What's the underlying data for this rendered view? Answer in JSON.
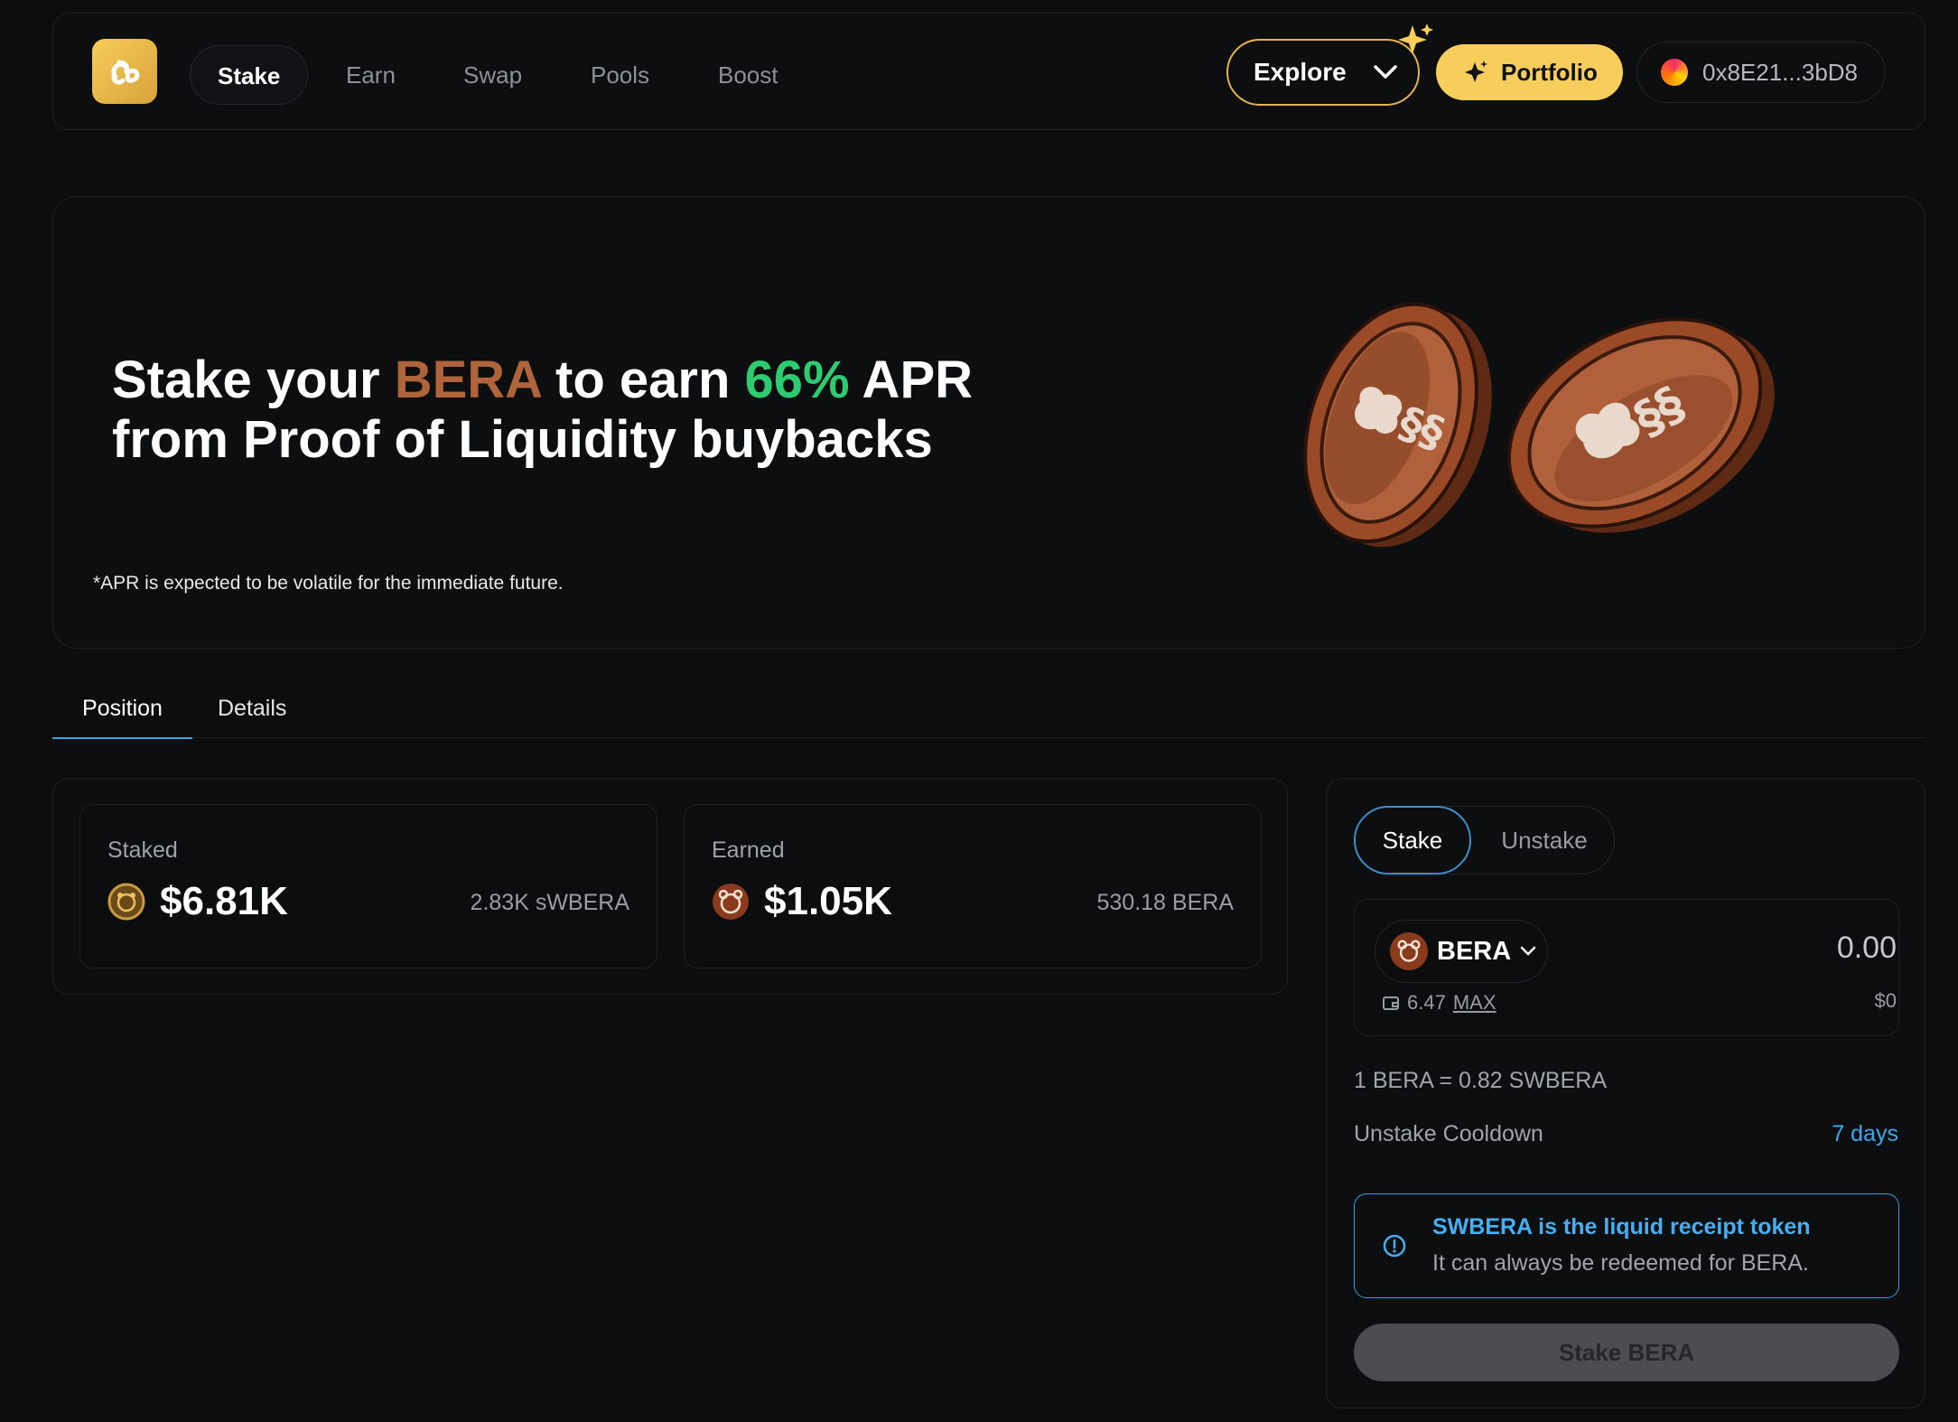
{
  "nav": {
    "links": [
      "Stake",
      "Earn",
      "Swap",
      "Pools",
      "Boost"
    ],
    "explore": "Explore",
    "portfolio": "Portfolio",
    "wallet": "0x8E21...3bD8"
  },
  "hero": {
    "line1_a": "Stake your ",
    "line1_b": "BERA",
    "line1_c": " to earn ",
    "line1_d": "66%",
    "line1_e": " APR",
    "line2": "from Proof of Liquidity buybacks",
    "disclaimer": "*APR is expected to be volatile for the immediate future."
  },
  "tabs": {
    "position": "Position",
    "details": "Details"
  },
  "position": {
    "staked": {
      "label": "Staked",
      "value": "$6.81K",
      "amount": "2.83K  sWBERA"
    },
    "earned": {
      "label": "Earned",
      "value": "$1.05K",
      "amount": "530.18  BERA"
    }
  },
  "stake": {
    "tab_stake": "Stake",
    "tab_unstake": "Unstake",
    "token": "BERA",
    "amount": "0.00",
    "usd": "$0",
    "balance": "6.47",
    "max": "MAX",
    "rate": "1 BERA = 0.82 SWBERA",
    "cooldown_label": "Unstake Cooldown",
    "cooldown_value": "7 days",
    "info_title": "SWBERA is the liquid receipt token",
    "info_body": "It can always be redeemed for BERA.",
    "button": "Stake BERA"
  },
  "colors": {
    "accent": "#f7cd5b",
    "bera": "#b0643a",
    "apr": "#2ecc71",
    "info": "#3a9ae0"
  },
  "icons": [
    "logo-icon",
    "chevron-down-icon",
    "sparkle-icon",
    "wallet-avatar-icon",
    "coin-icon",
    "bear-token-icon",
    "wallet-icon",
    "info-icon"
  ]
}
